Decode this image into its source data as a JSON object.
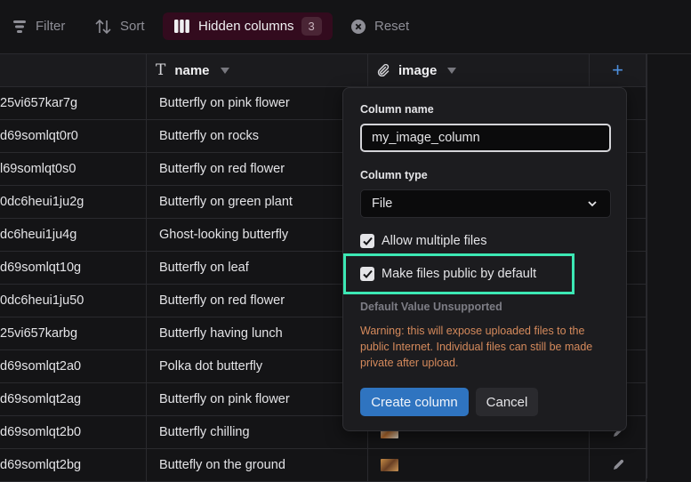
{
  "toolbar": {
    "filter_label": "Filter",
    "sort_label": "Sort",
    "hidden_columns_label": "Hidden columns",
    "hidden_columns_count": "3",
    "reset_label": "Reset"
  },
  "table": {
    "columns": [
      {
        "label": "",
        "icon": "none"
      },
      {
        "label": "name",
        "icon": "text-type-icon"
      },
      {
        "label": "image",
        "icon": "paperclip-icon"
      },
      {
        "label": "+",
        "icon": "plus-icon"
      }
    ],
    "rows": [
      {
        "id": "25vi657kar7g",
        "name": "Butterfly on pink flower",
        "thumb": "none"
      },
      {
        "id": "d69somlqt0r0",
        "name": "Butterfly on rocks",
        "thumb": "none"
      },
      {
        "id": "l69somlqt0s0",
        "name": "Butterfly on red flower",
        "thumb": "none"
      },
      {
        "id": "0dc6heui1ju2g",
        "name": "Butterfly on green plant",
        "thumb": "none"
      },
      {
        "id": "dc6heui1ju4g",
        "name": "Ghost-looking butterfly",
        "thumb": "none"
      },
      {
        "id": "d69somlqt10g",
        "name": "Butterfly on leaf",
        "thumb": "none"
      },
      {
        "id": "0dc6heui1ju50",
        "name": "Butterfly on red flower",
        "thumb": "none"
      },
      {
        "id": "25vi657karbg",
        "name": "Butterfly having lunch",
        "thumb": "none"
      },
      {
        "id": "d69somlqt2a0",
        "name": "Polka dot butterfly",
        "thumb": "none"
      },
      {
        "id": "d69somlqt2ag",
        "name": "Butterfly on pink flower",
        "thumb": "none"
      },
      {
        "id": "d69somlqt2b0",
        "name": "Butterfly chilling",
        "thumb": "image"
      },
      {
        "id": "d69somlqt2bg",
        "name": "Buttefly on the ground",
        "thumb": "image"
      }
    ]
  },
  "popover": {
    "column_name_label": "Column name",
    "column_name_value": "my_image_column",
    "column_type_label": "Column type",
    "column_type_value": "File",
    "allow_multiple_label": "Allow multiple files",
    "allow_multiple_checked": true,
    "make_public_label": "Make files public by default",
    "make_public_checked": true,
    "default_value_title": "Default Value Unsupported",
    "warning_text": "Warning: this will expose uploaded files to the public Internet. Individual files can still be made private after upload.",
    "create_label": "Create column",
    "cancel_label": "Cancel"
  },
  "colors": {
    "accent": "#2f74c0",
    "highlight": "#3ce8b4",
    "warning": "#d58a5c",
    "hidden_columns_bg": "#330b1e"
  }
}
